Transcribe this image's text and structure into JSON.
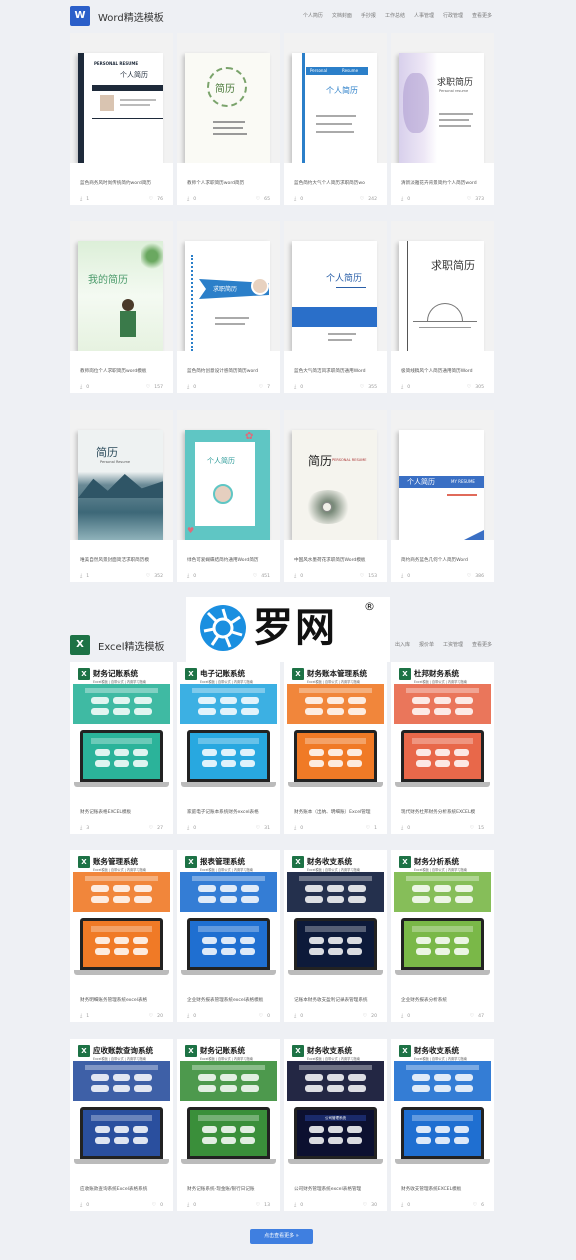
{
  "word_section": {
    "logo": "W",
    "title": "Word精选模板",
    "nav": [
      "个人简历",
      "文档封面",
      "手抄报",
      "工作总结",
      "人事管理",
      "行政管理",
      "查看更多"
    ]
  },
  "excel_section": {
    "logo": "X",
    "title": "Excel精选模板",
    "nav": [
      "出入库",
      "报价单",
      "工资管理",
      "查看更多"
    ]
  },
  "word_cards": [
    {
      "title": "蓝色商务风时尚传统简约word简历",
      "downloads": "1",
      "likes": "76",
      "cover_text": [
        "PERSONAL RESUME",
        "个人简历",
        "个人资料"
      ]
    },
    {
      "title": "教师个人求职简历word简历",
      "downloads": "0",
      "likes": "65",
      "cover_text": [
        "简历"
      ]
    },
    {
      "title": "蓝色简约大气个人简历求职简历wo",
      "downloads": "0",
      "likes": "242",
      "cover_text": [
        "Personal",
        "Resume",
        "个人简历"
      ]
    },
    {
      "title": "清新淡雅花卉背景简约个人简历word",
      "downloads": "0",
      "likes": "373",
      "cover_text": [
        "求职简历",
        "Personal resume"
      ]
    },
    {
      "title": "教师岗位个人求职简历word模板",
      "downloads": "0",
      "likes": "157",
      "cover_text": [
        "我的简历"
      ]
    },
    {
      "title": "蓝色简约创意设计感简历简历word",
      "downloads": "0",
      "likes": "7",
      "cover_text": [
        "求职简历"
      ]
    },
    {
      "title": "蓝色大气简洁风求职简历通用Word",
      "downloads": "0",
      "likes": "355",
      "cover_text": [
        "个人简历"
      ]
    },
    {
      "title": "极简线稿风个人简历通用简历Word",
      "downloads": "0",
      "likes": "305",
      "cover_text": [
        "求职简历"
      ]
    },
    {
      "title": "唯美自然风景封面简洁求职简历模",
      "downloads": "1",
      "likes": "352",
      "cover_text": [
        "简历",
        "Personal Resume"
      ]
    },
    {
      "title": "绿色可爱蝴蝶结简约通用Word简历",
      "downloads": "0",
      "likes": "451",
      "cover_text": [
        "个人简历"
      ]
    },
    {
      "title": "中国风水墨荷花求职简历Word模板",
      "downloads": "0",
      "likes": "153",
      "cover_text": [
        "简历",
        "PERSONAL RESUME"
      ]
    },
    {
      "title": "简约商务蓝色几何个人简历Word",
      "downloads": "0",
      "likes": "386",
      "cover_text": [
        "个人简历",
        "MY RESUME"
      ]
    }
  ],
  "excel_cards": [
    {
      "title": "财务记账表格EXCEL模板",
      "downloads": "3",
      "likes": "27",
      "name": "财务记账系统",
      "sub": "Excel模板 | 自带公式 | 内置学习指南",
      "theme": "#2bb39a"
    },
    {
      "title": "家庭电子记账本系统财务excel表格",
      "downloads": "0",
      "likes": "31",
      "name": "电子记账系统",
      "sub": "Excel模板 | 自带公式 | 内置学习指南",
      "theme": "#28a8e0"
    },
    {
      "title": "财务账本（出纳、明细账）Excel管理",
      "downloads": "0",
      "likes": "1",
      "name": "财务账本管理系统",
      "sub": "Excel模板 | 自带公式 | 内置学习指南",
      "theme": "#f07a26"
    },
    {
      "title": "现代财务杜邦财务分析系统EXCEL模",
      "downloads": "0",
      "likes": "15",
      "name": "杜邦财务系统",
      "sub": "Excel模板 | 自带公式 | 内置学习指南",
      "theme": "#e8684a"
    },
    {
      "title": "财务明细账务管理系统excel表格",
      "downloads": "1",
      "likes": "20",
      "name": "账务管理系统",
      "sub": "Excel模板 | 自带公式 | 内置学习指南",
      "theme": "#f07a26"
    },
    {
      "title": "企业财务报表管理系统excel表格模板",
      "downloads": "0",
      "likes": "0",
      "name": "报表管理系统",
      "sub": "Excel模板 | 自带公式 | 内置学习指南",
      "theme": "#1f6fd1"
    },
    {
      "title": "记账本财务收支盈利记录表管理系统",
      "downloads": "0",
      "likes": "20",
      "name": "财务收支系统",
      "sub": "Excel模板 | 自带公式 | 内置学习指南",
      "theme": "#0d1a3a"
    },
    {
      "title": "企业财务报表分析系统",
      "downloads": "0",
      "likes": "47",
      "name": "财务分析系统",
      "sub": "Excel模板 | 自带公式 | 内置学习指南",
      "theme": "#7ab848"
    },
    {
      "title": "应收账款查询系统Excel表格系统",
      "downloads": "0",
      "likes": "0",
      "name": "应收账款查询系统",
      "sub": "Excel模板 | 自带公式 | 内置学习指南",
      "theme": "#2a4f9e"
    },
    {
      "title": "财务记账系统-现金账/银行日记账",
      "downloads": "0",
      "likes": "13",
      "name": "财务记账系统",
      "sub": "Excel模板 | 自带公式 | 内置学习指南",
      "theme": "#3a8f3a"
    },
    {
      "title": "公司财务管理系统excel表格管理",
      "downloads": "0",
      "likes": "30",
      "name": "财务收支系统",
      "sub": "Excel模板 | 自带公式 | 内置学习指南",
      "theme": "#0c1030",
      "screen_text": "公司管理系统"
    },
    {
      "title": "财务收支管理系统EXCEL模板",
      "downloads": "0",
      "likes": "6",
      "name": "财务收支系统",
      "sub": "Excel模板 | 自带公式 | 内置学习指南",
      "theme": "#1f6fd1"
    }
  ],
  "watermark": {
    "text": "罗网",
    "reg": "®"
  },
  "more_button": "点击查看更多 »"
}
